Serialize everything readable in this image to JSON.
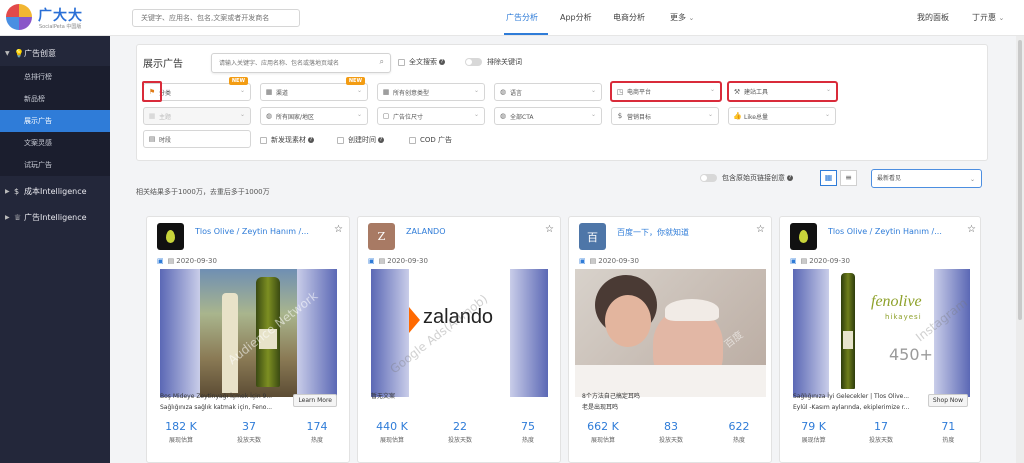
{
  "brand": {
    "name": "广大大",
    "sub": "SocialPeta 中国版"
  },
  "top_search": {
    "placeholder": "关键字、应用名、包名,文案或者开发商名"
  },
  "nav": {
    "ads": "广告分析",
    "app": "App分析",
    "ecom": "电商分析",
    "more": "更多"
  },
  "top_right": {
    "dashboard": "我的面板",
    "user": "丁亓惠"
  },
  "sidebar": {
    "group1": "广告创意",
    "items": [
      "总排行榜",
      "新品榜",
      "展示广告",
      "文案灵感",
      "试玩广告"
    ],
    "group2": "成本Intelligence",
    "group3": "广告Intelligence"
  },
  "panel": {
    "title": "展示广告",
    "search_placeholder": "请输入关键字、应用名称、包名或落地页域名",
    "fulltext": "全文搜索",
    "exclude": "排除关键词",
    "filters": {
      "category": "分类",
      "channel": "渠道",
      "creative_type": "所有创意类型",
      "language": "语言",
      "ecom_platform": "电商平台",
      "site_tool": "建站工具",
      "topic": "主题",
      "region": "所有国家/地区",
      "ad_size": "广告位尺寸",
      "cta": "全部CTA",
      "marketing_goal": "营销目标",
      "likes": "Like总量",
      "period": "时段"
    },
    "new_badge": "NEW",
    "check_new": "新发现素材",
    "check_created": "创建时间",
    "check_cod": "COD 广告"
  },
  "results": {
    "summary": "相关结果多于1000万，去重后多于1000万",
    "include_original": "包含原始页链接创意",
    "sort": "最新看见"
  },
  "cards": [
    {
      "advertiser": "Tlos Olive / Zeytin Hanım /...",
      "date": "2020-09-30",
      "line1": "Boş Mideye Zeytinyağı İçmek İçin 9...",
      "line2": "Sağlığınıza sağlık katmak için, Feno...",
      "cta": "Learn More",
      "impressions": "182 K",
      "days": "37",
      "heat": "174"
    },
    {
      "advertiser": "ZALANDO",
      "avatar_letter": "Z",
      "date": "2020-09-30",
      "line1": "暂无文案",
      "line2": "",
      "brand_text": "zalando",
      "impressions": "440 K",
      "days": "22",
      "heat": "75"
    },
    {
      "advertiser": "百度一下，你就知道",
      "avatar_letter": "百",
      "date": "2020-09-30",
      "line1": "8个方法自己搞定耳鸣",
      "line2": "老是出现耳鸣",
      "impressions": "662 K",
      "days": "83",
      "heat": "622"
    },
    {
      "advertiser": "Tlos Olive / Zeytin Hanım /...",
      "date": "2020-09-30",
      "line1": "Sağlığınıza İyi Gelecekler | Tlos Olive...",
      "line2": "Eylül -Kasım aylarında, ekiplerimize r...",
      "cta": "Shop Now",
      "brand_text": "fenolive",
      "brand_sub": "hikayesi",
      "badge_text": "450+",
      "impressions": "79 K",
      "days": "17",
      "heat": "71"
    }
  ],
  "stat_labels": {
    "impressions": "展现估算",
    "days": "投放天数",
    "heat": "热度"
  },
  "watermarks": {
    "google": "Google Ads(Admob)",
    "network": "Audience Network",
    "instagram": "Instagram",
    "baidu": "百度"
  }
}
